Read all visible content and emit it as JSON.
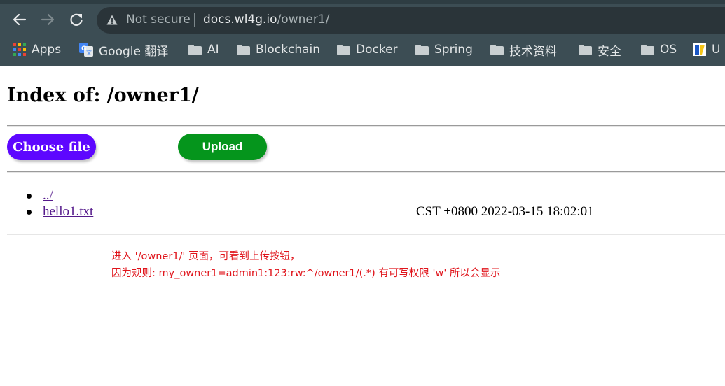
{
  "browser": {
    "security_label": "Not secure",
    "url_host": "docs.wl4g.io",
    "url_path": "/owner1/",
    "bookmarks": [
      {
        "label": "Apps",
        "icon": "apps-grid-icon"
      },
      {
        "label": "Google 翻译",
        "icon": "google-translate-icon"
      },
      {
        "label": "AI",
        "icon": "folder-icon"
      },
      {
        "label": "Blockchain",
        "icon": "folder-icon"
      },
      {
        "label": "Docker",
        "icon": "folder-icon"
      },
      {
        "label": "Spring",
        "icon": "folder-icon"
      },
      {
        "label": "技术资料",
        "icon": "folder-icon"
      },
      {
        "label": "安全",
        "icon": "folder-icon"
      },
      {
        "label": "OS",
        "icon": "folder-icon"
      },
      {
        "label": "U",
        "icon": "bookmark-favicon-icon"
      }
    ]
  },
  "page": {
    "title": "Index of: /owner1/",
    "choose_file_label": "Choose file",
    "upload_label": "Upload",
    "files": [
      {
        "name": "../",
        "date": ""
      },
      {
        "name": "hello1.txt",
        "date": "CST +0800 2022-03-15 18:02:01"
      }
    ],
    "note_lines": [
      "进入 '/owner1/' 页面，可看到上传按钮，",
      "因为规则: my_owner1=admin1:123:rw:^/owner1/(.*) 有可写权限 'w' 所以会显示"
    ]
  },
  "colors": {
    "choose_button": "#5d07ff",
    "upload_button": "#05951c",
    "annotation": "#e0141b",
    "link": "#551a8b"
  }
}
